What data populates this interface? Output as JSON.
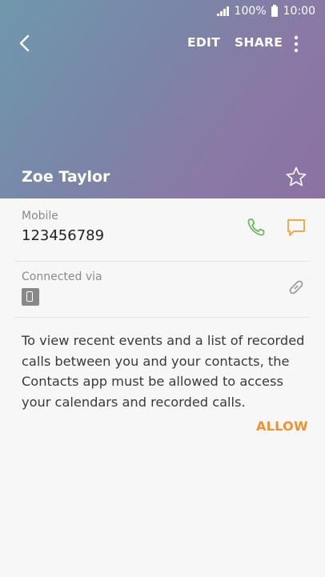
{
  "status_bar": {
    "battery_percent": "100%",
    "time": "10:00"
  },
  "toolbar": {
    "edit_label": "EDIT",
    "share_label": "SHARE"
  },
  "contact": {
    "name": "Zoe Taylor",
    "phone_type": "Mobile",
    "phone_number": "123456789",
    "connected_via_label": "Connected via"
  },
  "permission": {
    "message": "To view recent events and a list of recorded calls between you and your contacts, the Contacts app must be allowed to access your calendars and recorded calls.",
    "allow_label": "ALLOW"
  },
  "colors": {
    "accent_orange": "#f0922a",
    "call_green": "#5fb44d",
    "message_orange": "#f0a030"
  },
  "icons": {
    "back": "back-arrow-icon",
    "more": "more-options-icon",
    "star": "star-icon",
    "call": "phone-icon",
    "message": "message-icon",
    "link": "link-icon",
    "device": "device-icon"
  }
}
